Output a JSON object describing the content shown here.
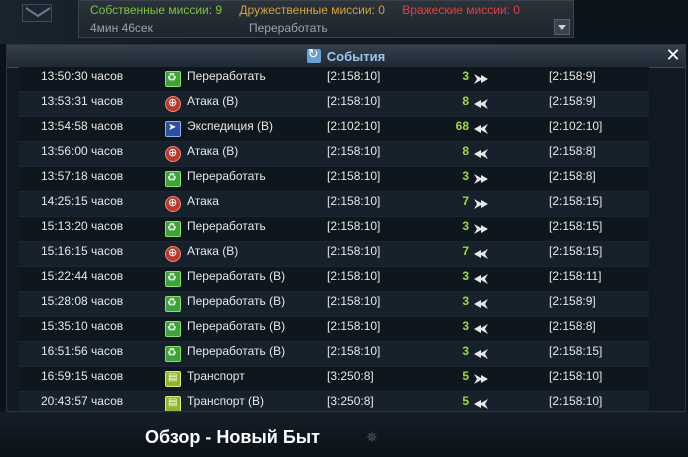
{
  "top": {
    "own_missions": "Собственные миссии: 9",
    "friendly_missions": "Дружественные миссии: 0",
    "enemy_missions": "Вражеские миссии: 0",
    "timer": "4мин 46сек",
    "selected_mission": "Переработать"
  },
  "panel": {
    "title": "События"
  },
  "events": [
    {
      "time": "13:50:30 часов",
      "icon": "recycle-icon",
      "type": "Переработать",
      "from": "[2:158:10]",
      "count": "3",
      "direction": "outgoing",
      "to": "[2:158:9]"
    },
    {
      "time": "13:53:31 часов",
      "icon": "attack-icon",
      "type": "Атака (В)",
      "from": "[2:158:10]",
      "count": "8",
      "direction": "return",
      "to": "[2:158:9]"
    },
    {
      "time": "13:54:58 часов",
      "icon": "expedition-icon",
      "type": "Экспедиция (В)",
      "from": "[2:102:10]",
      "count": "68",
      "direction": "return",
      "to": "[2:102:10]"
    },
    {
      "time": "13:56:00 часов",
      "icon": "attack-icon",
      "type": "Атака (В)",
      "from": "[2:158:10]",
      "count": "8",
      "direction": "return",
      "to": "[2:158:8]"
    },
    {
      "time": "13:57:18 часов",
      "icon": "recycle-icon",
      "type": "Переработать",
      "from": "[2:158:10]",
      "count": "3",
      "direction": "outgoing",
      "to": "[2:158:8]"
    },
    {
      "time": "14:25:15 часов",
      "icon": "attack-icon",
      "type": "Атака",
      "from": "[2:158:10]",
      "count": "7",
      "direction": "outgoing",
      "to": "[2:158:15]"
    },
    {
      "time": "15:13:20 часов",
      "icon": "recycle-icon",
      "type": "Переработать",
      "from": "[2:158:10]",
      "count": "3",
      "direction": "outgoing",
      "to": "[2:158:15]"
    },
    {
      "time": "15:16:15 часов",
      "icon": "attack-icon",
      "type": "Атака (В)",
      "from": "[2:158:10]",
      "count": "7",
      "direction": "return",
      "to": "[2:158:15]"
    },
    {
      "time": "15:22:44 часов",
      "icon": "recycle-icon",
      "type": "Переработать (В)",
      "from": "[2:158:10]",
      "count": "3",
      "direction": "return",
      "to": "[2:158:11]"
    },
    {
      "time": "15:28:08 часов",
      "icon": "recycle-icon",
      "type": "Переработать (В)",
      "from": "[2:158:10]",
      "count": "3",
      "direction": "return",
      "to": "[2:158:9]"
    },
    {
      "time": "15:35:10 часов",
      "icon": "recycle-icon",
      "type": "Переработать (В)",
      "from": "[2:158:10]",
      "count": "3",
      "direction": "return",
      "to": "[2:158:8]"
    },
    {
      "time": "16:51:56 часов",
      "icon": "recycle-icon",
      "type": "Переработать (В)",
      "from": "[2:158:10]",
      "count": "3",
      "direction": "return",
      "to": "[2:158:15]"
    },
    {
      "time": "16:59:15 часов",
      "icon": "transport-icon",
      "type": "Транспорт",
      "from": "[3:250:8]",
      "count": "5",
      "direction": "outgoing",
      "to": "[2:158:10]"
    },
    {
      "time": "20:43:57 часов",
      "icon": "transport-icon",
      "type": "Транспорт (В)",
      "from": "[3:250:8]",
      "count": "5",
      "direction": "return",
      "to": "[2:158:10]"
    }
  ],
  "footer": {
    "title": "Обзор - Новый Быт"
  },
  "colors": {
    "own": "#7ec43a",
    "friendly": "#d6a33a",
    "enemy": "#e04040",
    "count": "#9cdc3a",
    "title": "#9fc4ea"
  }
}
